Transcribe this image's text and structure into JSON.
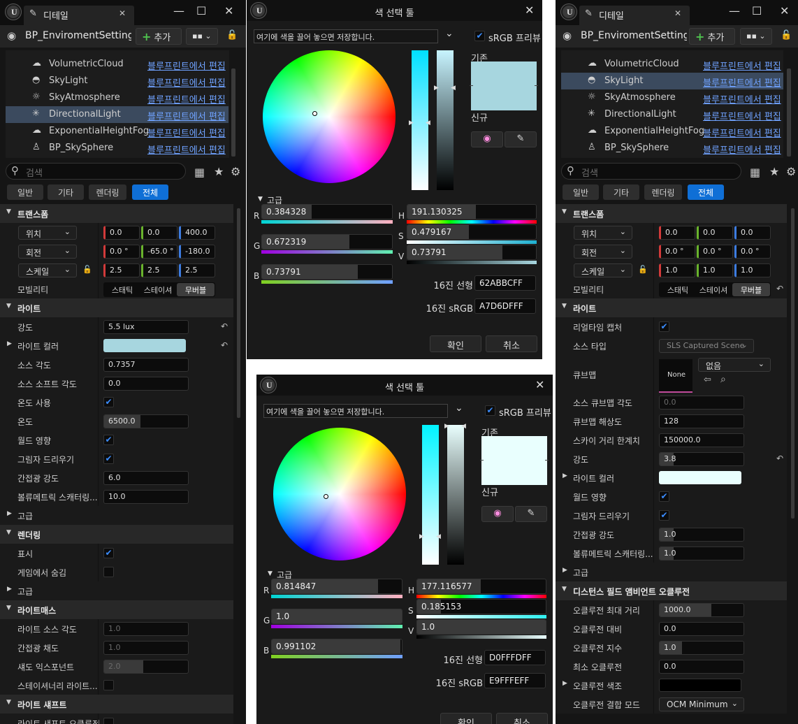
{
  "left_panel": {
    "tab_title": "디테일",
    "blueprint": "BP_EnviromentSetting",
    "add_label": "추가",
    "components": [
      {
        "name": "VolumetricCloud",
        "icon": "cloud-icon",
        "edit": "블루프린트에서 편집"
      },
      {
        "name": "SkyLight",
        "icon": "skylight-icon",
        "edit": "블루프린트에서 편집"
      },
      {
        "name": "SkyAtmosphere",
        "icon": "atmosphere-icon",
        "edit": "블루프린트에서 편집"
      },
      {
        "name": "DirectionalLight",
        "icon": "sun-icon",
        "edit": "블루프린트에서 편집"
      },
      {
        "name": "ExponentialHeightFog",
        "icon": "fog-icon",
        "edit": "블루프린트에서 편집"
      },
      {
        "name": "BP_SkySphere",
        "icon": "actor-icon",
        "edit": "블루프린트에서 편집"
      }
    ],
    "search_placeholder": "검색",
    "filter_tabs": [
      "일반",
      "기타",
      "렌더링",
      "전체"
    ],
    "transform": {
      "title": "트랜스폼",
      "location": {
        "label": "위치",
        "x": "0.0",
        "y": "0.0",
        "z": "400.0"
      },
      "rotation": {
        "label": "회전",
        "x": "0.0 °",
        "y": "-65.0 °",
        "z": "-180.0"
      },
      "scale": {
        "label": "스케일",
        "x": "2.5",
        "y": "2.5",
        "z": "2.5"
      },
      "mobility": {
        "label": "모빌리티",
        "options": [
          "스태틱",
          "스테이셔",
          "무버블"
        ],
        "selected": 2
      }
    },
    "light": {
      "title": "라이트",
      "intensity": {
        "label": "강도",
        "value": "5.5 lux"
      },
      "light_color": {
        "label": "라이트 컬러",
        "color": "#A7D6DF"
      },
      "source_angle": {
        "label": "소스 각도",
        "value": "0.7357"
      },
      "source_soft_angle": {
        "label": "소스 소프트 각도",
        "value": "0.0"
      },
      "use_temperature": {
        "label": "온도 사용"
      },
      "temperature": {
        "label": "온도",
        "value": "6500.0"
      },
      "affects_world": {
        "label": "월드 영향"
      },
      "cast_shadows": {
        "label": "그림자 드리우기"
      },
      "indirect_intensity": {
        "label": "간접광 강도",
        "value": "6.0"
      },
      "volumetric_scattering": {
        "label": "볼류메트릭 스캐터링...",
        "value": "10.0"
      },
      "advanced": "고급"
    },
    "rendering": {
      "title": "렌더링",
      "visible": "표시",
      "hidden_in_game": "게임에서 숨김",
      "advanced": "고급"
    },
    "lightmass": {
      "title": "라이트매스",
      "source_angle": {
        "label": "라이트 소스 각도",
        "value": "1.0"
      },
      "indirect_saturation": {
        "label": "간접광 채도",
        "value": "1.0"
      },
      "shadow_exponent": {
        "label": "섀도 익스포넌트",
        "value": "2.0"
      },
      "stationary_light": {
        "label": "스테이셔너리 라이트..."
      }
    },
    "light_shafts": {
      "title": "라이트 섀프트",
      "occlusion": "라이트 섀프트 오클루전"
    }
  },
  "color_picker_1": {
    "title": "색 선택 툴",
    "hint": "여기에 색을 끌어 놓으면 저장합니다.",
    "srgb_label": "sRGB 프리뷰",
    "old_label": "기존",
    "new_label": "신규",
    "old_color": "#A7D6DF",
    "new_color": "#A7D6DF",
    "advanced": "고급",
    "r": {
      "label": "R",
      "value": "0.384328",
      "fraction": 0.384328
    },
    "g": {
      "label": "G",
      "value": "0.672319",
      "fraction": 0.672319
    },
    "b": {
      "label": "B",
      "value": "0.73791",
      "fraction": 0.73791
    },
    "h": {
      "label": "H",
      "value": "191.130325",
      "fraction": 0.5309
    },
    "s": {
      "label": "S",
      "value": "0.479167",
      "fraction": 0.479167
    },
    "v": {
      "label": "V",
      "value": "0.73791",
      "fraction": 0.73791
    },
    "hex_linear_label": "16진 선형",
    "hex_linear": "62ABBCFF",
    "hex_srgb_label": "16진 sRGB",
    "hex_srgb": "A7D6DFFF",
    "ok": "확인",
    "cancel": "취소"
  },
  "color_picker_2": {
    "title": "색 선택 툴",
    "hint": "여기에 색을 끌어 놓으면 저장합니다.",
    "srgb_label": "sRGB 프리뷰",
    "old_label": "기존",
    "new_label": "신규",
    "old_color": "#E9FFFE",
    "new_color": "#E9FFFE",
    "advanced": "고급",
    "r": {
      "label": "R",
      "value": "0.814847",
      "fraction": 0.814847
    },
    "g": {
      "label": "G",
      "value": "1.0",
      "fraction": 1.0
    },
    "b": {
      "label": "B",
      "value": "0.991102",
      "fraction": 0.991102
    },
    "h": {
      "label": "H",
      "value": "177.116577",
      "fraction": 0.492
    },
    "s": {
      "label": "S",
      "value": "0.185153",
      "fraction": 0.185153
    },
    "v": {
      "label": "V",
      "value": "1.0",
      "fraction": 1.0
    },
    "hex_linear_label": "16진 선형",
    "hex_linear": "D0FFFDFF",
    "hex_srgb_label": "16진 sRGB",
    "hex_srgb": "E9FFFEFF",
    "ok": "확인",
    "cancel": "취소"
  },
  "right_panel": {
    "tab_title": "디테일",
    "blueprint": "BP_EnviromentSetting",
    "add_label": "추가",
    "components": [
      {
        "name": "VolumetricCloud",
        "icon": "cloud-icon",
        "edit": "블루프린트에서 편집"
      },
      {
        "name": "SkyLight",
        "icon": "skylight-icon",
        "edit": "블루프린트에서 편집"
      },
      {
        "name": "SkyAtmosphere",
        "icon": "atmosphere-icon",
        "edit": "블루프린트에서 편집"
      },
      {
        "name": "DirectionalLight",
        "icon": "sun-icon",
        "edit": "블루프린트에서 편집"
      },
      {
        "name": "ExponentialHeightFog",
        "icon": "fog-icon",
        "edit": "블루프린트에서 편집"
      },
      {
        "name": "BP_SkySphere",
        "icon": "actor-icon",
        "edit": "블루프린트에서 편집"
      }
    ],
    "search_placeholder": "검색",
    "filter_tabs": [
      "일반",
      "기타",
      "렌더링",
      "전체"
    ],
    "transform": {
      "title": "트랜스폼",
      "location": {
        "label": "위치",
        "x": "0.0",
        "y": "0.0",
        "z": "0.0"
      },
      "rotation": {
        "label": "회전",
        "x": "0.0 °",
        "y": "0.0 °",
        "z": "0.0 °"
      },
      "scale": {
        "label": "스케일",
        "x": "1.0",
        "y": "1.0",
        "z": "1.0"
      },
      "mobility": {
        "label": "모빌리티",
        "options": [
          "스태틱",
          "스테이셔",
          "무버블"
        ],
        "selected": 2
      }
    },
    "light": {
      "title": "라이트",
      "realtime_capture": "리얼타임 캡처",
      "source_type": {
        "label": "소스 타입",
        "value": "SLS Captured Scene"
      },
      "cubemap": {
        "label": "큐브맵",
        "thumb": "None",
        "value": "없음"
      },
      "source_cubemap_angle": {
        "label": "소스 큐브맵 각도",
        "value": "0.0"
      },
      "cubemap_resolution": {
        "label": "큐브맵 해상도",
        "value": "128"
      },
      "sky_distance_threshold": {
        "label": "스카이 거리 한계치",
        "value": "150000.0"
      },
      "intensity": {
        "label": "강도",
        "value": "3.8"
      },
      "light_color": {
        "label": "라이트 컬러",
        "color": "#E9FFFE"
      },
      "affects_world": "월드 영향",
      "cast_shadows": "그림자 드리우기",
      "indirect_intensity": {
        "label": "간접광 강도",
        "value": "1.0"
      },
      "volumetric_scattering": {
        "label": "볼류메트릭 스캐터링...",
        "value": "1.0"
      },
      "advanced": "고급"
    },
    "dfao": {
      "title": "디스턴스 필드 앰비언트 오클루전",
      "max_distance": {
        "label": "오클루전 최대 거리",
        "value": "1000.0"
      },
      "contrast": {
        "label": "오클루전 대비",
        "value": "0.0"
      },
      "exponent": {
        "label": "오클루전 지수",
        "value": "1.0"
      },
      "min_occlusion": {
        "label": "최소 오클루전",
        "value": "0.0"
      },
      "tint": {
        "label": "오클루전 색조",
        "color": "#000000"
      },
      "combine_mode": {
        "label": "오클루전 결합 모드",
        "value": "OCM Minimum"
      }
    }
  }
}
